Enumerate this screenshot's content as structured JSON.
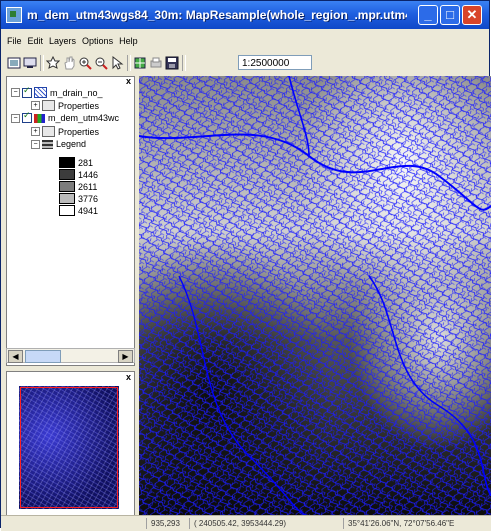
{
  "window": {
    "title": "m_dem_utm43wgs84_30m: MapResample(whole_region_.mpr.utm43wgs8...",
    "min_glyph": "_",
    "max_glyph": "□",
    "close_glyph": "✕"
  },
  "menu": [
    "File",
    "Edit",
    "Layers",
    "Options",
    "Help"
  ],
  "toolbar": {
    "scale_value": "1:2500000"
  },
  "layers_panel": {
    "close_glyph": "x",
    "layers": [
      {
        "name": "m_drain_no_",
        "expander": "−"
      },
      {
        "name": "m_dem_utm43wc",
        "expander": "−"
      }
    ],
    "properties_label": "Properties",
    "legend_label": "Legend",
    "legend": [
      {
        "value": "281",
        "color": "#000000"
      },
      {
        "value": "1446",
        "color": "#3c3c3c"
      },
      {
        "value": "2611",
        "color": "#7c7c7c"
      },
      {
        "value": "3776",
        "color": "#bcbcbc"
      },
      {
        "value": "4941",
        "color": "#ffffff"
      }
    ]
  },
  "overview_panel": {
    "close_glyph": "x"
  },
  "statusbar": {
    "pixel": "935,293",
    "coords": "( 240505.42, 3953444.29)",
    "latlon": "35°41'26.06\"N, 72°07'56.46\"E"
  },
  "colors": {
    "drainage": "#1a1aff",
    "titlebar": "#1f5fe0"
  }
}
